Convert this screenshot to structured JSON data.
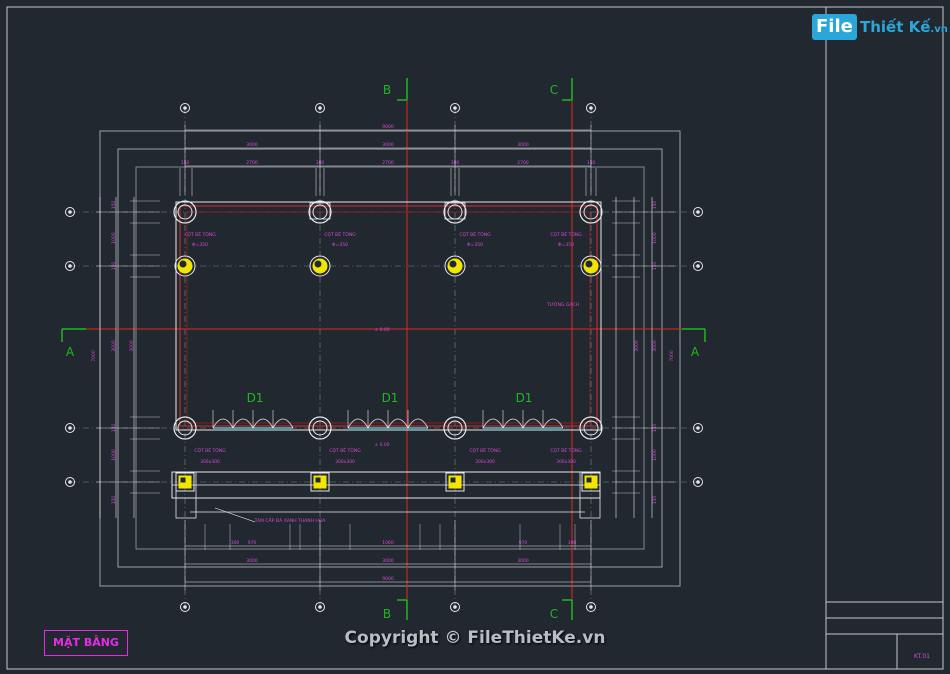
{
  "logo": {
    "file": "File",
    "rest": "Thiết Kế",
    "suffix": ".vn"
  },
  "drawing_title": "MẶT BẰNG",
  "watermark": "Copyright © FileThietKe.vn",
  "sheet_id": "KT.01",
  "section_marks": {
    "a": "A",
    "b": "B",
    "c": "C"
  },
  "column_labels": {
    "round": "CỘT BÊ TÔNG",
    "round_sizes": [
      "Φ=350",
      "Φ=350",
      "Φ=350",
      "Φ=350"
    ],
    "square": "CỘT BÊ TÔNG",
    "square_size": "300x300"
  },
  "door_tag": "D1",
  "wall_note": "TƯỜNG GẠCH",
  "level_marks": {
    "main": "± 0.00",
    "step": "± 0.00"
  },
  "stair_note": "TAM CẤP ĐÁ XANH THANH HÓA",
  "dims_top": {
    "total": "9000",
    "bays": [
      "3000",
      "3000",
      "3000"
    ],
    "sub": [
      "2700",
      "300",
      "2700",
      "300",
      "2700"
    ],
    "edge": [
      "150",
      "150"
    ]
  },
  "dims_bottom": {
    "total": "9000",
    "bays": [
      "3000",
      "3000",
      "3000"
    ],
    "sub": [
      "300",
      "970",
      "1060",
      "970",
      "300"
    ]
  },
  "dims_side": {
    "total": "7000",
    "center": "3000",
    "upper": [
      "150",
      "1000",
      "150"
    ],
    "lower": [
      "150",
      "1000",
      "150"
    ]
  }
}
